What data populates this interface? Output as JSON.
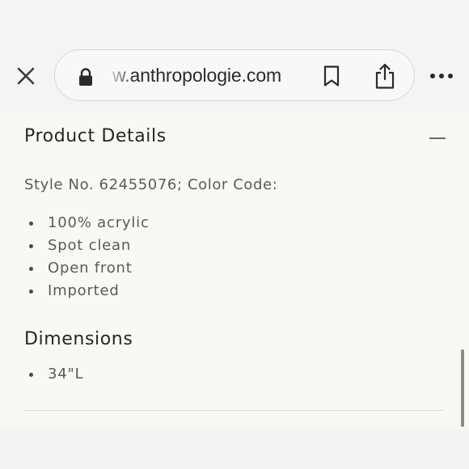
{
  "browser": {
    "url_text": "w.anthropologie.com",
    "close_icon": "close-icon",
    "lock_icon": "lock-icon",
    "bookmark_icon": "bookmark-icon",
    "share_icon": "share-icon",
    "more_icon": "more-icon"
  },
  "product_details": {
    "title": "Product Details",
    "toggle_icon": "minus-icon",
    "style_line": "Style No. 62455076; Color Code:",
    "items": [
      "100% acrylic",
      "Spot clean",
      "Open front",
      "Imported"
    ]
  },
  "dimensions": {
    "title": "Dimensions",
    "items": [
      "34\"L"
    ]
  },
  "colors": {
    "background": "#f9f9f4",
    "toolbar": "#f4f4f2",
    "text": "#2f2f2f",
    "muted_text": "#5a5a5a"
  }
}
